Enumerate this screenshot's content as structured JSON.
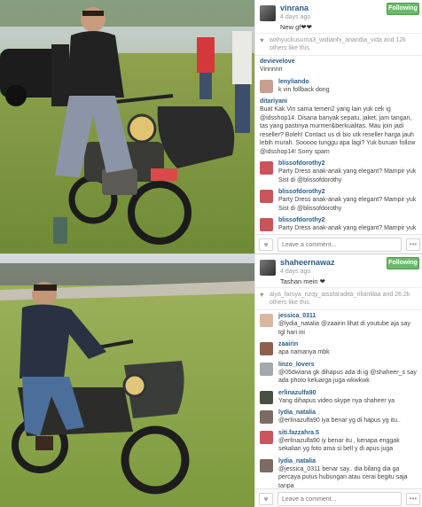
{
  "posts": [
    {
      "username": "vinrana",
      "time": "4 days ago",
      "follow_label": "Following",
      "caption": "New gf❤❤",
      "likes_text": "wahyuckusuma3_widianhi_anandia_vida and 12k others like this.",
      "comment_placeholder": "Leave a comment...",
      "comments": [
        {
          "user": "devievelove",
          "text": "Vinnnnn"
        },
        {
          "user": "lenyliando",
          "text": "k vin follback dong"
        },
        {
          "user": "ditariyani",
          "text": "Buat Kak Vin sama temen2 yang lain yuk cek ig @idsshop14. Disana banyak sepatu, jaket, jam tangan, tas yang pastinya murmer&berkualitas. Mau join jadi reseller? Boleh! Contact us di bio utk reseller harga jauh lebih murah. Sooooo tunggu apa lagi? Yuk buruan follow @idsshop14! Sorry spam"
        },
        {
          "user": "blissofdorothy2",
          "text": "Party Dress anak-anak yang elegant? Mampir yuk Sist di @blissofdorothy"
        },
        {
          "user": "blissofdorothy2",
          "text": "Party Dress anak-anak yang elegant? Mampir yuk Sist di @blissofdorothy"
        },
        {
          "user": "blissofdorothy2",
          "text": "Party Dress anak-anak yang elegant? Mampir yuk Sist di @blissofdorothy"
        }
      ]
    },
    {
      "username": "shaheernawaz",
      "time": "4 days ago",
      "follow_label": "Following",
      "caption": "Tashan mein ❤",
      "likes_text": "alya_farsya_rizqy_aisafaradita_rilianlilaa and 26.2k others like this.",
      "comment_placeholder": "Leave a comment...",
      "comments": [
        {
          "user": "jessica_0311",
          "text": "@lydia_natalia @zaairin lihat di youtube aja say tgl hari ini"
        },
        {
          "user": "zaairin",
          "text": "apa namanya mbk"
        },
        {
          "user": "linzo_lovers",
          "text": "@05dwiana gk dihapus ada di ig @shaheer_s say ada photo keluarga juga wkwkwk"
        },
        {
          "user": "erlinazulfa90",
          "text": "Yang dihapus video skype nya shaheer ya"
        },
        {
          "user": "lydia_natalia",
          "text": "@erlinazulfa90 iya benar yg di hapus yg itu.."
        },
        {
          "user": "siti.fazzahra.5",
          "text": "@erlinazulfa90 iy benar itu , kenapa enggak sekalian yg foto ama si bell y di apus juga"
        },
        {
          "user": "lydia_natalia",
          "text": "@jessica_0311 benar say.. dia bilang dia ga percaya putus hubungan atau cerai begitu saja tanpa"
        }
      ]
    }
  ],
  "colors": {
    "username": "#2b5c86",
    "follow_button": "#6bb96b",
    "muted_text": "#999999"
  },
  "icons": {
    "like": "heart-icon",
    "more": "ellipsis-icon"
  }
}
